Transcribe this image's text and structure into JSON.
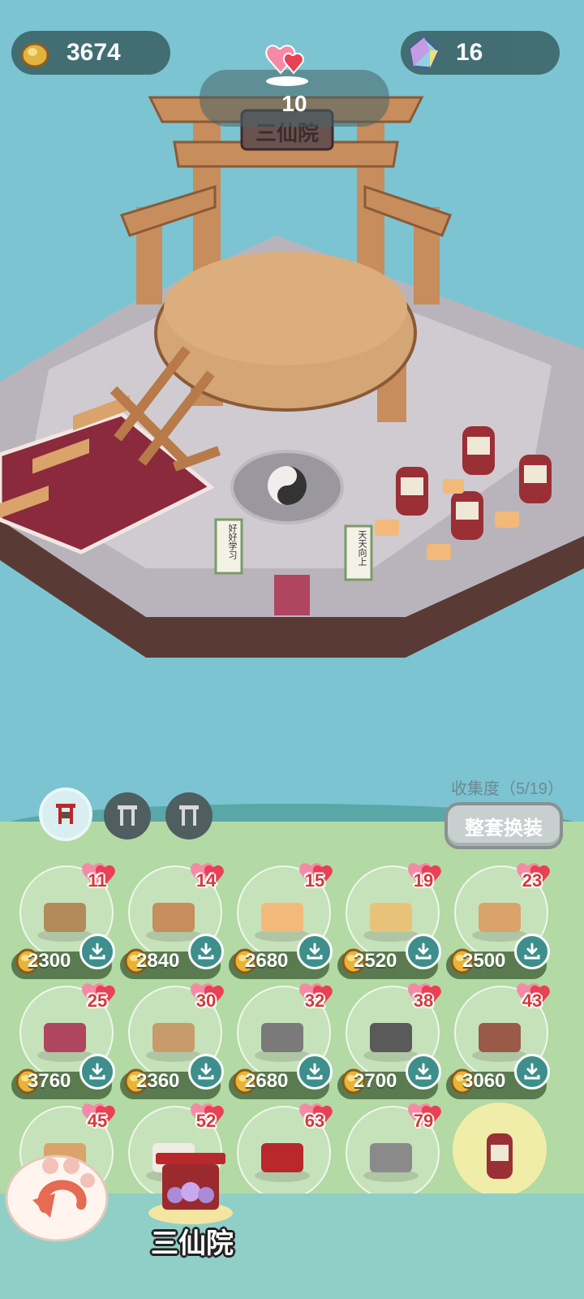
{
  "hud": {
    "gold": "3674",
    "gems": "16",
    "love": "10"
  },
  "scene": {
    "gate_sign": "三仙院",
    "scroll_left": "好好学习",
    "scroll_right": "天天向上"
  },
  "panel": {
    "collection_label": "收集度（5/19）",
    "swap_button": "整套换装",
    "tabs": [
      "tab-1",
      "tab-2",
      "tab-3"
    ],
    "items": [
      {
        "hearts": "11",
        "price": "2300"
      },
      {
        "hearts": "14",
        "price": "2840"
      },
      {
        "hearts": "15",
        "price": "2680"
      },
      {
        "hearts": "19",
        "price": "2520"
      },
      {
        "hearts": "23",
        "price": "2500"
      },
      {
        "hearts": "25",
        "price": "3760"
      },
      {
        "hearts": "30",
        "price": "2360"
      },
      {
        "hearts": "32",
        "price": "2680"
      },
      {
        "hearts": "38",
        "price": "2700"
      },
      {
        "hearts": "43",
        "price": "3060"
      },
      {
        "hearts": "45"
      },
      {
        "hearts": "52"
      },
      {
        "hearts": "63"
      },
      {
        "hearts": "79"
      }
    ],
    "set_name": "三仙院"
  },
  "colors": {
    "sky": "#7cc4d1",
    "panel_green": "#b3d9a4",
    "price_red": "#d23a3a",
    "gold": "#e9b338"
  }
}
